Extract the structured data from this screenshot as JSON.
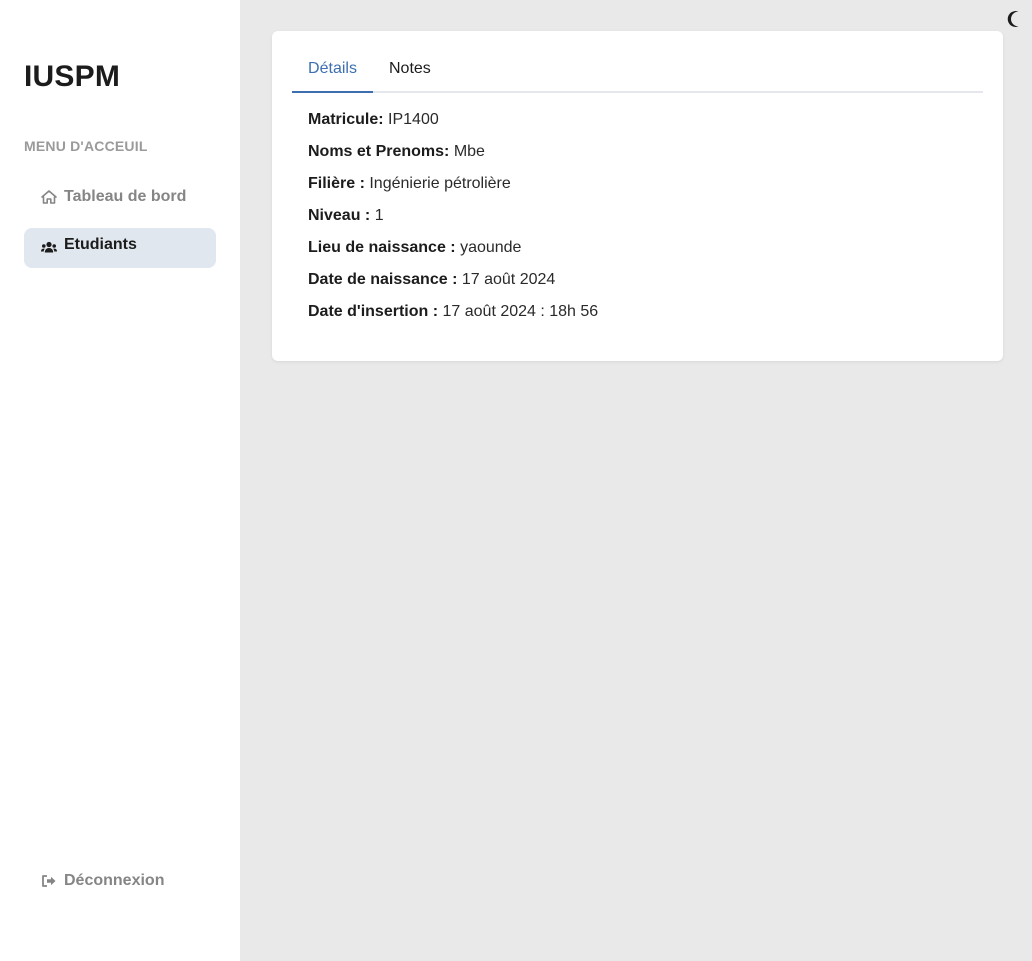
{
  "sidebar": {
    "brand": "IUSPM",
    "menu_heading": "MENU D'ACCEUIL",
    "items": [
      {
        "label": "Tableau de bord",
        "icon": "home-icon",
        "active": false
      },
      {
        "label": "Etudiants",
        "icon": "users-icon",
        "active": true
      }
    ],
    "logout": {
      "label": "Déconnexion",
      "icon": "logout-icon"
    }
  },
  "header": {
    "theme_toggle_icon": "moon-icon"
  },
  "tabs": [
    {
      "label": "Détails",
      "active": true
    },
    {
      "label": "Notes",
      "active": false
    }
  ],
  "details": [
    {
      "key": "Matricule:",
      "value": "IP1400"
    },
    {
      "key": "Noms et Prenoms:",
      "value": "Mbe"
    },
    {
      "key": "Filière :",
      "value": "Ingénierie pétrolière"
    },
    {
      "key": "Niveau :",
      "value": "1"
    },
    {
      "key": "Lieu de naissance :",
      "value": "yaounde"
    },
    {
      "key": "Date de naissance :",
      "value": "17 août 2024"
    },
    {
      "key": "Date d'insertion :",
      "value": "17 août 2024 : 18h 56"
    }
  ],
  "colors": {
    "accent": "#3d6fb0",
    "active_nav_bg": "#e1e7ee",
    "page_bg": "#e9e9e9"
  }
}
